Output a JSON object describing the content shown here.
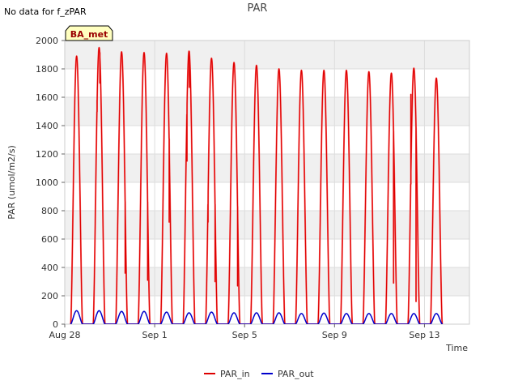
{
  "notice": "No data for f_zPAR",
  "badge": "BA_met",
  "colors": {
    "par_in": "#dd0000",
    "par_in_light": "#ff5555",
    "par_out": "#0000cc",
    "band": "#f0f0f0",
    "badge_fill": "#ffffc0",
    "badge_text": "#990000"
  },
  "chart_data": {
    "type": "line",
    "title": "PAR",
    "xlabel": "Time",
    "ylabel": "PAR (umol/m2/s)",
    "ylim": [
      0,
      2000
    ],
    "yticks": [
      0,
      200,
      400,
      600,
      800,
      1000,
      1200,
      1400,
      1600,
      1800,
      2000
    ],
    "xlim": [
      "2021-08-28",
      "2021-09-15"
    ],
    "xticks": [
      {
        "value": "2021-08-28",
        "label": "Aug 28"
      },
      {
        "value": "2021-09-01",
        "label": "Sep 1"
      },
      {
        "value": "2021-09-05",
        "label": "Sep 5"
      },
      {
        "value": "2021-09-09",
        "label": "Sep 9"
      },
      {
        "value": "2021-09-13",
        "label": "Sep 13"
      }
    ],
    "grid": true,
    "legend_position": "bottom-center",
    "series": [
      {
        "name": "PAR_in",
        "solar_noon": "12:40",
        "day_length_hours": 12.6,
        "daily_peak": [
          {
            "date": "2021-08-28",
            "peak": 1890
          },
          {
            "date": "2021-08-29",
            "peak": 1950
          },
          {
            "date": "2021-08-30",
            "peak": 1920
          },
          {
            "date": "2021-08-31",
            "peak": 1915
          },
          {
            "date": "2021-09-01",
            "peak": 1910
          },
          {
            "date": "2021-09-02",
            "peak": 1925
          },
          {
            "date": "2021-09-03",
            "peak": 1875
          },
          {
            "date": "2021-09-04",
            "peak": 1845
          },
          {
            "date": "2021-09-05",
            "peak": 1825
          },
          {
            "date": "2021-09-06",
            "peak": 1800
          },
          {
            "date": "2021-09-07",
            "peak": 1790
          },
          {
            "date": "2021-09-08",
            "peak": 1790
          },
          {
            "date": "2021-09-09",
            "peak": 1790
          },
          {
            "date": "2021-09-10",
            "peak": 1780
          },
          {
            "date": "2021-09-11",
            "peak": 1770
          },
          {
            "date": "2021-09-12",
            "peak": 1805
          },
          {
            "date": "2021-09-13",
            "peak": 1735
          }
        ],
        "dips": [
          {
            "time": "2021-08-29T10:30",
            "value": 1580
          },
          {
            "time": "2021-08-29T13:30",
            "value": 1700
          },
          {
            "time": "2021-08-30T16:30",
            "value": 360
          },
          {
            "time": "2021-08-31T16:30",
            "value": 310
          },
          {
            "time": "2021-09-01T15:30",
            "value": 720
          },
          {
            "time": "2021-09-02T10:30",
            "value": 1150
          },
          {
            "time": "2021-09-02T13:00",
            "value": 1670
          },
          {
            "time": "2021-09-03T09:00",
            "value": 720
          },
          {
            "time": "2021-09-03T16:30",
            "value": 300
          },
          {
            "time": "2021-09-04T16:30",
            "value": 270
          },
          {
            "time": "2021-09-11T15:00",
            "value": 290
          },
          {
            "time": "2021-09-12T09:30",
            "value": 1620
          },
          {
            "time": "2021-09-12T15:00",
            "value": 160
          }
        ]
      },
      {
        "name": "PAR_out",
        "solar_noon": "12:40",
        "day_length_hours": 12.6,
        "daily_peak": [
          {
            "date": "2021-08-28",
            "peak": 95
          },
          {
            "date": "2021-08-29",
            "peak": 95
          },
          {
            "date": "2021-08-30",
            "peak": 90
          },
          {
            "date": "2021-08-31",
            "peak": 90
          },
          {
            "date": "2021-09-01",
            "peak": 85
          },
          {
            "date": "2021-09-02",
            "peak": 80
          },
          {
            "date": "2021-09-03",
            "peak": 85
          },
          {
            "date": "2021-09-04",
            "peak": 80
          },
          {
            "date": "2021-09-05",
            "peak": 80
          },
          {
            "date": "2021-09-06",
            "peak": 80
          },
          {
            "date": "2021-09-07",
            "peak": 75
          },
          {
            "date": "2021-09-08",
            "peak": 78
          },
          {
            "date": "2021-09-09",
            "peak": 75
          },
          {
            "date": "2021-09-10",
            "peak": 75
          },
          {
            "date": "2021-09-11",
            "peak": 75
          },
          {
            "date": "2021-09-12",
            "peak": 75
          },
          {
            "date": "2021-09-13",
            "peak": 75
          }
        ]
      }
    ]
  }
}
